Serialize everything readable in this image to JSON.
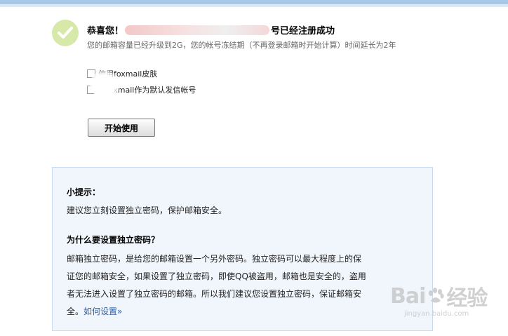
{
  "header": {
    "title_prefix": "恭喜您！",
    "title_suffix": "号已经注册成功",
    "subtitle": "您的邮箱容量已经升级到2G，您的帐号冻结期（不再登录邮箱时开始计算）时间延长为2年"
  },
  "options": {
    "skin_label": "使用foxmail皮肤",
    "default_label": "将foxmail作为默认发信帐号"
  },
  "start_button": {
    "label": "开始使用"
  },
  "tips": {
    "title": "小提示：",
    "text": "建议您立刻设置独立密码，保护邮箱安全。",
    "why_title": "为什么要设置独立密码？",
    "why_lines": [
      "邮箱独立密码，是给您的邮箱设置一个另外密码。独立密码可以最大程度上的保",
      "证您的邮箱安全，如果设置了独立密码，即使QQ被盗用，邮箱也是安全的，盗用",
      "者无法进入设置了独立密码的邮箱。所以我们建议您设置独立密码，保证邮箱安"
    ],
    "why_last": "全。",
    "how_link": "如何设置»"
  },
  "watermark": {
    "brand": "Bai",
    "brand2": "经验",
    "sub": "jingyan.baidu.com"
  },
  "colors": {
    "accent_link": "#2a5db0",
    "success_green": "#c8e09a",
    "tips_bg": "#f1f6fc",
    "tips_border": "#c9d9ee"
  }
}
